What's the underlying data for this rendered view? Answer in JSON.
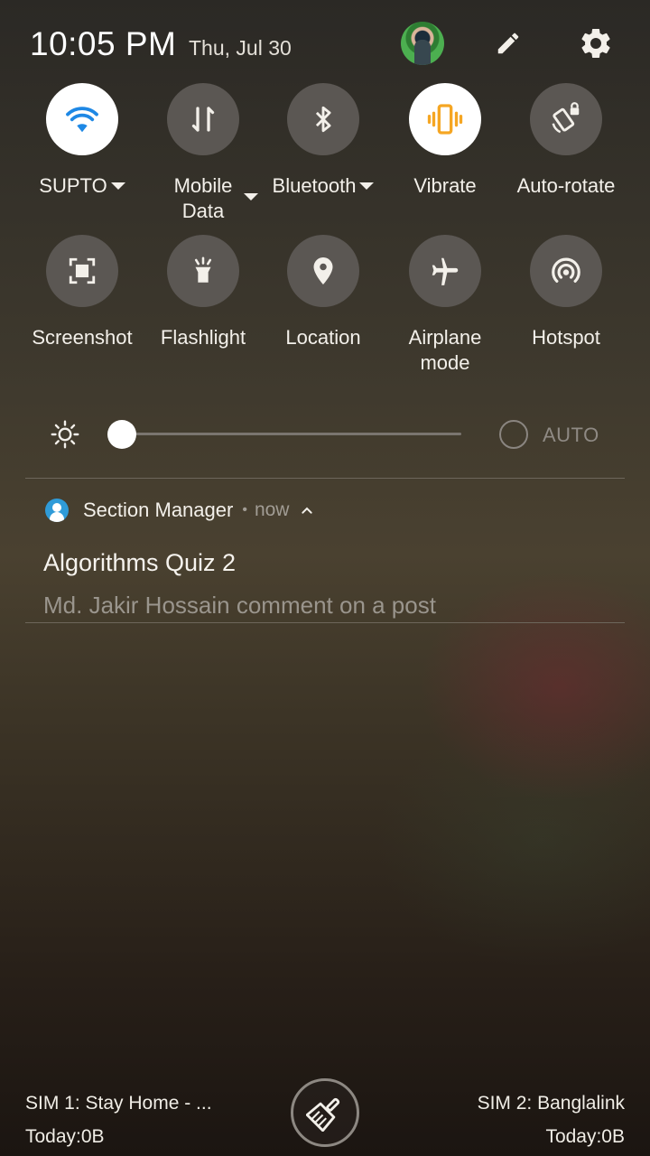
{
  "status": {
    "time": "10:05 PM",
    "date": "Thu, Jul 30"
  },
  "header_icons": [
    "avatar",
    "edit-icon",
    "settings-icon"
  ],
  "tiles_row1": [
    {
      "label": "SUPTO",
      "icon": "wifi-icon",
      "active": true,
      "dropdown": true
    },
    {
      "label": "Mobile Data",
      "icon": "mobile-data-icon",
      "active": false,
      "dropdown": true
    },
    {
      "label": "Bluetooth",
      "icon": "bluetooth-icon",
      "active": false,
      "dropdown": true
    },
    {
      "label": "Vibrate",
      "icon": "vibrate-icon",
      "active": true,
      "dropdown": false
    },
    {
      "label": "Auto-rotate",
      "icon": "auto-rotate-icon",
      "active": false,
      "dropdown": false
    }
  ],
  "tiles_row2": [
    {
      "label": "Screenshot",
      "icon": "screenshot-icon",
      "active": false
    },
    {
      "label": "Flashlight",
      "icon": "flashlight-icon",
      "active": false
    },
    {
      "label": "Location",
      "icon": "location-icon",
      "active": false
    },
    {
      "label": "Airplane mode",
      "icon": "airplane-icon",
      "active": false
    },
    {
      "label": "Hotspot",
      "icon": "hotspot-icon",
      "active": false
    }
  ],
  "mobile_data_label": {
    "line1": "Mobile",
    "line2": "Data"
  },
  "airplane_label": {
    "line1": "Airplane",
    "line2": "mode"
  },
  "brightness": {
    "level": 0.0,
    "auto_label": "AUTO",
    "auto_enabled": false
  },
  "notification": {
    "app_name": "Section Manager",
    "separator": "•",
    "when": "now",
    "title": "Algorithms Quiz 2",
    "text": "Md. Jakir Hossain comment on a post"
  },
  "footer": {
    "sim1_name": "SIM 1: Stay Home - ...",
    "sim1_data": "Today:0B",
    "sim2_name": "SIM 2: Banglalink",
    "sim2_data": "Today:0B"
  },
  "colors": {
    "tile_off": "#5b5753",
    "tile_on": "#ffffff",
    "wifi_accent": "#1e88e5",
    "vibrate_accent": "#f5a623"
  }
}
